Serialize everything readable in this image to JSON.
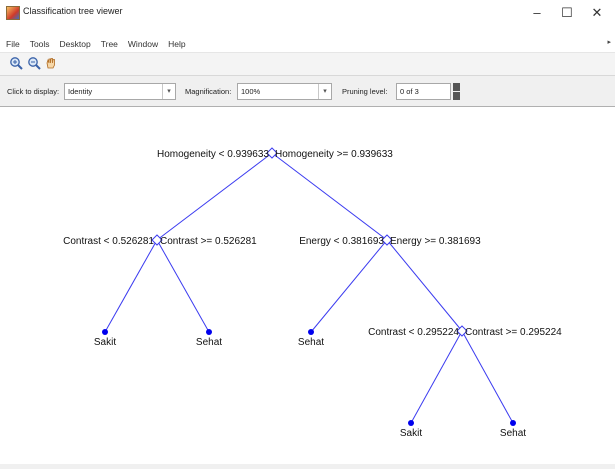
{
  "window": {
    "title": "Classification tree viewer",
    "minimize": "–",
    "maximize": "☐",
    "close": "✕"
  },
  "menu": {
    "items": [
      "File",
      "Tools",
      "Desktop",
      "Tree",
      "Window",
      "Help"
    ]
  },
  "toolbar": {
    "tools": [
      "zoom-in-icon",
      "zoom-out-icon",
      "pan-icon"
    ]
  },
  "controls": {
    "click_label": "Click to display:",
    "click_value": "Identity",
    "mag_label": "Magnification:",
    "mag_value": "100%",
    "prune_label": "Pruning level:",
    "prune_value": "0 of 3"
  },
  "tree": {
    "line_color": "#3b3bf0",
    "node_color": "#0000ee",
    "splits": {
      "root": {
        "left": "Homogeneity < 0.939633",
        "right": "Homogeneity >= 0.939633"
      },
      "n2": {
        "left": "Contrast < 0.526281",
        "right": "Contrast >= 0.526281"
      },
      "n3": {
        "left": "Energy < 0.381693",
        "right": "Energy >= 0.381693"
      },
      "n7": {
        "left": "Contrast < 0.295224",
        "right": "Contrast >= 0.295224"
      }
    },
    "leaves": {
      "l4": "Sakit",
      "l5": "Sehat",
      "l6": "Sehat",
      "l14": "Sakit",
      "l15": "Sehat"
    }
  }
}
